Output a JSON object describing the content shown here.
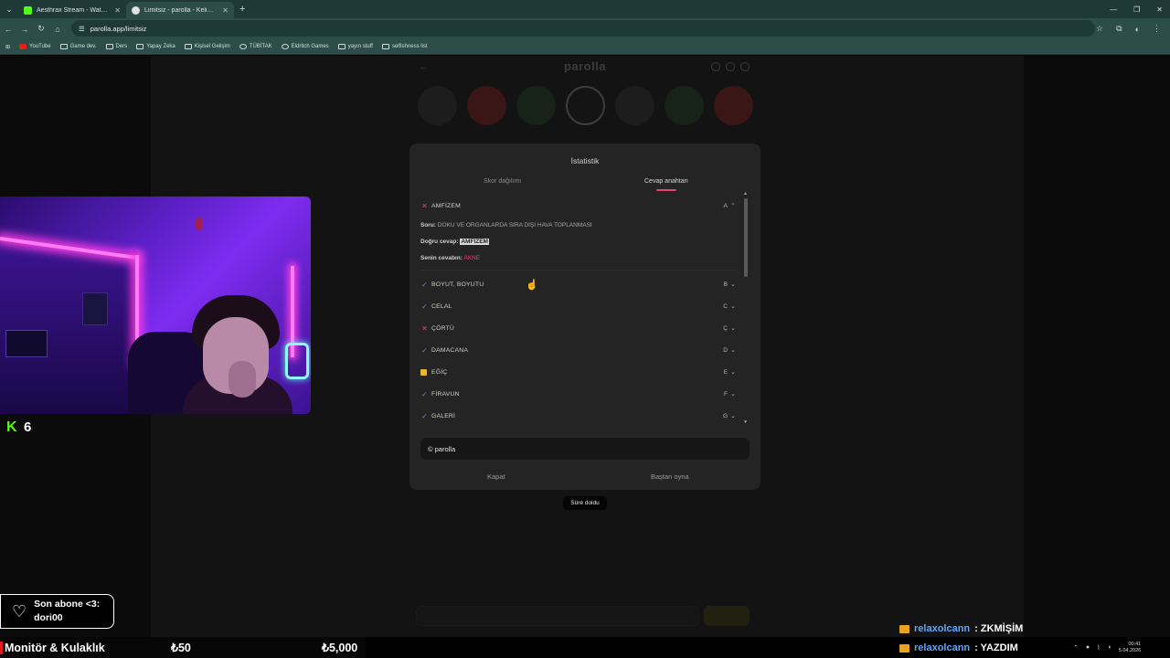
{
  "browser": {
    "tabs": [
      {
        "title": "Aesthrax Stream - Watch Live o",
        "favicon_color": "#53fc18",
        "active": false
      },
      {
        "title": "Limitsiz - parolla - Kelime oyunu",
        "favicon_color": "#e0e0e0",
        "active": true
      }
    ],
    "url": "parolla.app/limitsiz",
    "bookmarks": [
      "YouTube",
      "Game dev.",
      "Ders",
      "Yapay Zeka",
      "Kişisel Gelişim",
      "TÜBİTAK",
      "Eldritch Games",
      "yayın stuff",
      "selfishness list"
    ]
  },
  "app": {
    "logo": "parolla",
    "letter_states": [
      "dim",
      "red",
      "green",
      "cur",
      "dim",
      "green",
      "red"
    ]
  },
  "modal": {
    "title": "İstatistik",
    "tabs": [
      "Skor dağılımı",
      "Cevap anahtarı"
    ],
    "expanded": {
      "word": "AMFİZEM",
      "key": "A",
      "question_label": "Soru:",
      "question": "DOKU VE ORGANLARDA SIRA DIŞI HAVA TOPLANMASI",
      "correct_label": "Doğru cevap:",
      "correct": "AMFİZEM",
      "yours_label": "Senin cevabın:",
      "yours": "AKNE"
    },
    "rows": [
      {
        "word": "BOYUT, BOYUTU",
        "key": "B",
        "status": "correct"
      },
      {
        "word": "CELAL",
        "key": "C",
        "status": "correct"
      },
      {
        "word": "ÇÖRTÜ",
        "key": "Ç",
        "status": "wrong"
      },
      {
        "word": "DAMACANA",
        "key": "D",
        "status": "correct"
      },
      {
        "word": "EĞİÇ",
        "key": "E",
        "status": "passed"
      },
      {
        "word": "FİRAVUN",
        "key": "F",
        "status": "correct"
      },
      {
        "word": "GALERİ",
        "key": "G",
        "status": "correct"
      }
    ],
    "share_text": "© parolla",
    "close_label": "Kapat",
    "replay_label": "Baştan oyna"
  },
  "toast": "Süre doldu",
  "stream": {
    "viewer_count": "6",
    "sub_title": "Son abone <3:",
    "sub_name": "dori00",
    "ticker": [
      "Monitör & Kulaklık",
      "₺50",
      "₺5,000"
    ],
    "chat": [
      {
        "user": "relaxolcann",
        "msg": ": ZKMİŞİM"
      },
      {
        "user": "relaxolcann",
        "msg": ": YAZDIM"
      }
    ],
    "clock_time": "00:41",
    "clock_date": "5.04.2026"
  },
  "colors": {
    "accent": "#e8416a",
    "correct": "#8a7ad6",
    "passed": "#e8b535",
    "kick": "#53fc18"
  }
}
